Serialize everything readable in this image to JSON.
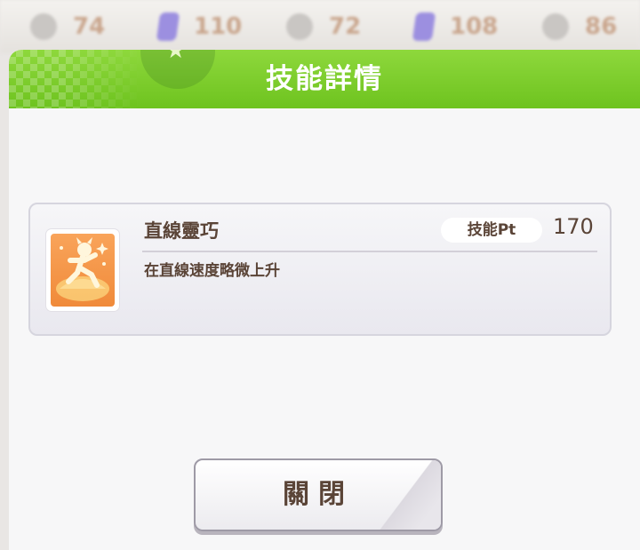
{
  "stats_bar": [
    {
      "icon": "speed-stat-icon",
      "value": "74"
    },
    {
      "icon": "stamina-stat-icon",
      "value": "110"
    },
    {
      "icon": "power-stat-icon",
      "value": "72"
    },
    {
      "icon": "guts-stat-icon",
      "value": "108"
    },
    {
      "icon": "wisdom-stat-icon",
      "value": "86"
    }
  ],
  "dialog": {
    "title": "技能詳情"
  },
  "skill": {
    "icon": "running-figure-icon",
    "name": "直線靈巧",
    "pt_label": "技能Pt",
    "pt_value": "170",
    "description": "在直線速度略微上升"
  },
  "close_button": {
    "label": "關閉"
  },
  "colors": {
    "header_green": "#7ccb2b",
    "text_brown": "#5a4437",
    "skill_icon_orange": "#f39a4a"
  }
}
